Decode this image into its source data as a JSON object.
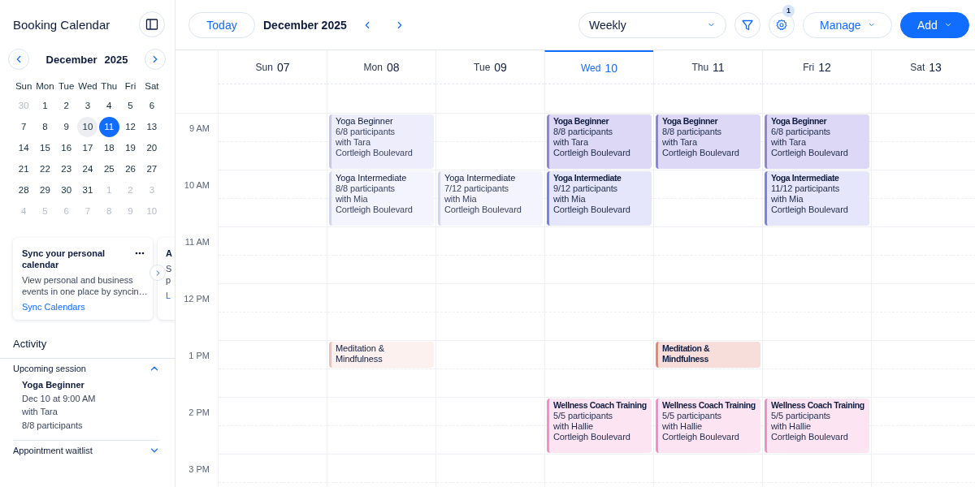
{
  "sidebar": {
    "title": "Booking Calendar"
  },
  "mini_calendar": {
    "month": "December",
    "year": "2025",
    "weekdays": [
      "Sun",
      "Mon",
      "Tue",
      "Wed",
      "Thu",
      "Fri",
      "Sat"
    ],
    "weeks": [
      [
        {
          "label": "30",
          "outside": true,
          "selected": false,
          "focused": false
        },
        {
          "label": "1",
          "outside": false,
          "selected": false,
          "focused": false
        },
        {
          "label": "2",
          "outside": false,
          "selected": false,
          "focused": false
        },
        {
          "label": "3",
          "outside": false,
          "selected": false,
          "focused": false
        },
        {
          "label": "4",
          "outside": false,
          "selected": false,
          "focused": false
        },
        {
          "label": "5",
          "outside": false,
          "selected": false,
          "focused": false
        },
        {
          "label": "6",
          "outside": false,
          "selected": false,
          "focused": false
        }
      ],
      [
        {
          "label": "7",
          "outside": false,
          "selected": false,
          "focused": false
        },
        {
          "label": "8",
          "outside": false,
          "selected": false,
          "focused": false
        },
        {
          "label": "9",
          "outside": false,
          "selected": false,
          "focused": false
        },
        {
          "label": "10",
          "outside": false,
          "selected": false,
          "focused": true
        },
        {
          "label": "11",
          "outside": false,
          "selected": true,
          "focused": false
        },
        {
          "label": "12",
          "outside": false,
          "selected": false,
          "focused": false
        },
        {
          "label": "13",
          "outside": false,
          "selected": false,
          "focused": false
        }
      ],
      [
        {
          "label": "14",
          "outside": false,
          "selected": false,
          "focused": false
        },
        {
          "label": "15",
          "outside": false,
          "selected": false,
          "focused": false
        },
        {
          "label": "16",
          "outside": false,
          "selected": false,
          "focused": false
        },
        {
          "label": "17",
          "outside": false,
          "selected": false,
          "focused": false
        },
        {
          "label": "18",
          "outside": false,
          "selected": false,
          "focused": false
        },
        {
          "label": "19",
          "outside": false,
          "selected": false,
          "focused": false
        },
        {
          "label": "20",
          "outside": false,
          "selected": false,
          "focused": false
        }
      ],
      [
        {
          "label": "21",
          "outside": false,
          "selected": false,
          "focused": false
        },
        {
          "label": "22",
          "outside": false,
          "selected": false,
          "focused": false
        },
        {
          "label": "23",
          "outside": false,
          "selected": false,
          "focused": false
        },
        {
          "label": "24",
          "outside": false,
          "selected": false,
          "focused": false
        },
        {
          "label": "25",
          "outside": false,
          "selected": false,
          "focused": false
        },
        {
          "label": "26",
          "outside": false,
          "selected": false,
          "focused": false
        },
        {
          "label": "27",
          "outside": false,
          "selected": false,
          "focused": false
        }
      ],
      [
        {
          "label": "28",
          "outside": false,
          "selected": false,
          "focused": false
        },
        {
          "label": "29",
          "outside": false,
          "selected": false,
          "focused": false
        },
        {
          "label": "30",
          "outside": false,
          "selected": false,
          "focused": false
        },
        {
          "label": "31",
          "outside": false,
          "selected": false,
          "focused": false
        },
        {
          "label": "1",
          "outside": true,
          "selected": false,
          "focused": false
        },
        {
          "label": "2",
          "outside": true,
          "selected": false,
          "focused": false
        },
        {
          "label": "3",
          "outside": true,
          "selected": false,
          "focused": false
        }
      ],
      [
        {
          "label": "4",
          "outside": true,
          "selected": false,
          "focused": false
        },
        {
          "label": "5",
          "outside": true,
          "selected": false,
          "focused": false
        },
        {
          "label": "6",
          "outside": true,
          "selected": false,
          "focused": false
        },
        {
          "label": "7",
          "outside": true,
          "selected": false,
          "focused": false
        },
        {
          "label": "8",
          "outside": true,
          "selected": false,
          "focused": false
        },
        {
          "label": "9",
          "outside": true,
          "selected": false,
          "focused": false
        },
        {
          "label": "10",
          "outside": true,
          "selected": false,
          "focused": false
        }
      ]
    ]
  },
  "cards": [
    {
      "title": "Sync your personal calendar",
      "body": [
        "View personal and business",
        "events in one place by syncin…"
      ],
      "link": "Sync Calendars",
      "cut": false
    },
    {
      "title": "A",
      "body": [
        "S",
        "p"
      ],
      "link": "L",
      "cut": true
    }
  ],
  "activity": {
    "title": "Activity",
    "sections": [
      {
        "title": "Upcoming session",
        "expanded": true,
        "session": {
          "title": "Yoga Beginner",
          "date": "Dec 10 at 9:00 AM",
          "instructor": "with Tara",
          "participants": "8/8 participants"
        }
      },
      {
        "title": "Appointment waitlist",
        "expanded": false
      }
    ]
  },
  "toolbar": {
    "today": "Today",
    "period": "December 2025",
    "view": "Weekly",
    "settings_badge": "1",
    "manage": "Manage",
    "add": "Add"
  },
  "days": [
    {
      "weekday": "Sun",
      "date": "07",
      "selected": false
    },
    {
      "weekday": "Mon",
      "date": "08",
      "selected": false
    },
    {
      "weekday": "Tue",
      "date": "09",
      "selected": false
    },
    {
      "weekday": "Wed",
      "date": "10",
      "selected": true
    },
    {
      "weekday": "Thu",
      "date": "11",
      "selected": false
    },
    {
      "weekday": "Fri",
      "date": "12",
      "selected": false
    },
    {
      "weekday": "Sat",
      "date": "13",
      "selected": false
    }
  ],
  "hours": [
    {
      "label": "9 AM",
      "cells": [
        null,
        {
          "kind": "beginner",
          "emphasized": false,
          "short": false,
          "title": "Yoga Beginner",
          "participants": "6/8 participants",
          "instructor": "with Tara",
          "location": "Cortleigh Boulevard"
        },
        null,
        {
          "kind": "beginner",
          "emphasized": true,
          "short": false,
          "title": "Yoga Beginner",
          "participants": "8/8 participants",
          "instructor": "with Tara",
          "location": "Cortleigh Boulevard"
        },
        {
          "kind": "beginner",
          "emphasized": true,
          "short": false,
          "title": "Yoga Beginner",
          "participants": "8/8 participants",
          "instructor": "with Tara",
          "location": "Cortleigh Boulevard"
        },
        {
          "kind": "beginner",
          "emphasized": true,
          "short": false,
          "title": "Yoga Beginner",
          "participants": "6/8 participants",
          "instructor": "with Tara",
          "location": "Cortleigh Boulevard"
        },
        null
      ]
    },
    {
      "label": "10 AM",
      "cells": [
        null,
        {
          "kind": "intermediate",
          "emphasized": false,
          "short": false,
          "title": "Yoga Intermediate",
          "participants": "8/8 participants",
          "instructor": "with Mia",
          "location": "Cortleigh Boulevard"
        },
        {
          "kind": "intermediate",
          "emphasized": false,
          "short": false,
          "title": "Yoga Intermediate",
          "participants": "7/12 participants",
          "instructor": "with Mia",
          "location": "Cortleigh Boulevard"
        },
        {
          "kind": "intermediate",
          "emphasized": true,
          "short": false,
          "title": "Yoga Intermediate",
          "participants": "9/12 participants",
          "instructor": "with Mia",
          "location": "Cortleigh Boulevard"
        },
        null,
        {
          "kind": "intermediate",
          "emphasized": true,
          "short": false,
          "title": "Yoga Intermediate",
          "participants": "11/12 participants",
          "instructor": "with Mia",
          "location": "Cortleigh Boulevard"
        },
        null
      ]
    },
    {
      "label": "11 AM",
      "cells": [
        null,
        null,
        null,
        null,
        null,
        null,
        null
      ]
    },
    {
      "label": "12 PM",
      "cells": [
        null,
        null,
        null,
        null,
        null,
        null,
        null
      ]
    },
    {
      "label": "1 PM",
      "cells": [
        null,
        {
          "kind": "meditation",
          "emphasized": false,
          "short": true,
          "title": "Meditation & Mindfulness"
        },
        null,
        null,
        {
          "kind": "meditation",
          "emphasized": true,
          "short": true,
          "title": "Meditation & Mindfulness"
        },
        null,
        null
      ]
    },
    {
      "label": "2 PM",
      "cells": [
        null,
        null,
        null,
        {
          "kind": "wellness",
          "emphasized": true,
          "short": false,
          "title": "Wellness Coach Training",
          "participants": "5/5 participants",
          "instructor": "with Hallie",
          "location": "Cortleigh Boulevard"
        },
        {
          "kind": "wellness",
          "emphasized": true,
          "short": false,
          "title": "Wellness Coach Training",
          "participants": "5/5 participants",
          "instructor": "with Hallie",
          "location": "Cortleigh Boulevard"
        },
        {
          "kind": "wellness",
          "emphasized": true,
          "short": false,
          "title": "Wellness Coach Training",
          "participants": "5/5 participants",
          "instructor": "with Hallie",
          "location": "Cortleigh Boulevard"
        },
        null
      ]
    },
    {
      "label": "3 PM",
      "cells": [
        null,
        null,
        null,
        null,
        null,
        null,
        null
      ]
    }
  ]
}
